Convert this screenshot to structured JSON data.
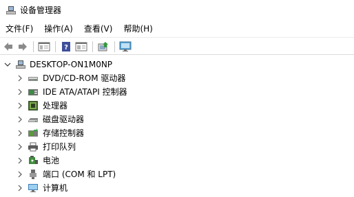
{
  "window": {
    "title": "设备管理器"
  },
  "menu": [
    "文件(F)",
    "操作(A)",
    "查看(V)",
    "帮助(H)"
  ],
  "tree": {
    "root": "DESKTOP-ON1M0NP",
    "items": [
      {
        "label": "DVD/CD-ROM 驱动器",
        "icon": "dvd-drive-icon"
      },
      {
        "label": "IDE ATA/ATAPI 控制器",
        "icon": "ide-controller-icon"
      },
      {
        "label": "处理器",
        "icon": "processor-icon"
      },
      {
        "label": "磁盘驱动器",
        "icon": "disk-drive-icon"
      },
      {
        "label": "存储控制器",
        "icon": "storage-controller-icon"
      },
      {
        "label": "打印队列",
        "icon": "printer-icon"
      },
      {
        "label": "电池",
        "icon": "battery-icon"
      },
      {
        "label": "端口 (COM 和 LPT)",
        "icon": "port-icon"
      },
      {
        "label": "计算机",
        "icon": "computer-icon"
      }
    ]
  }
}
